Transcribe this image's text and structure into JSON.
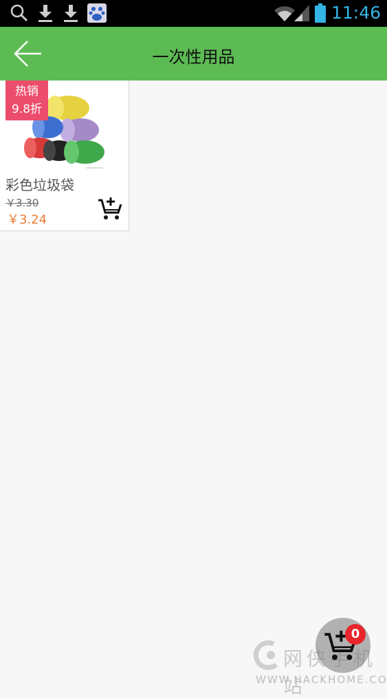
{
  "status_bar": {
    "time": "11:46",
    "icons": [
      "search-icon",
      "download-icon",
      "download-icon",
      "baidu-icon",
      "wifi-icon",
      "signal-icon",
      "battery-icon"
    ]
  },
  "header": {
    "title": "一次性用品",
    "back_icon": "arrow-left-icon",
    "background": "#5dbb54"
  },
  "products": [
    {
      "name": "彩色垃圾袋",
      "badge_line1": "热销",
      "badge_line2": "9.8折",
      "original_price": "￥3.30",
      "price": "￥3.24",
      "image": "colorful-trash-bag-rolls",
      "cart_icon": "add-to-cart-icon"
    }
  ],
  "floating_cart": {
    "count": "0",
    "icon": "add-to-cart-icon"
  },
  "watermark": {
    "name": "网侠手机站",
    "url": "WWW.HACKHOME.COM"
  },
  "colors": {
    "accent": "#5dbb54",
    "badge": "#ec4d6c",
    "price": "#e97c36",
    "count_badge": "#e8262c",
    "status_time": "#33b5e5"
  }
}
